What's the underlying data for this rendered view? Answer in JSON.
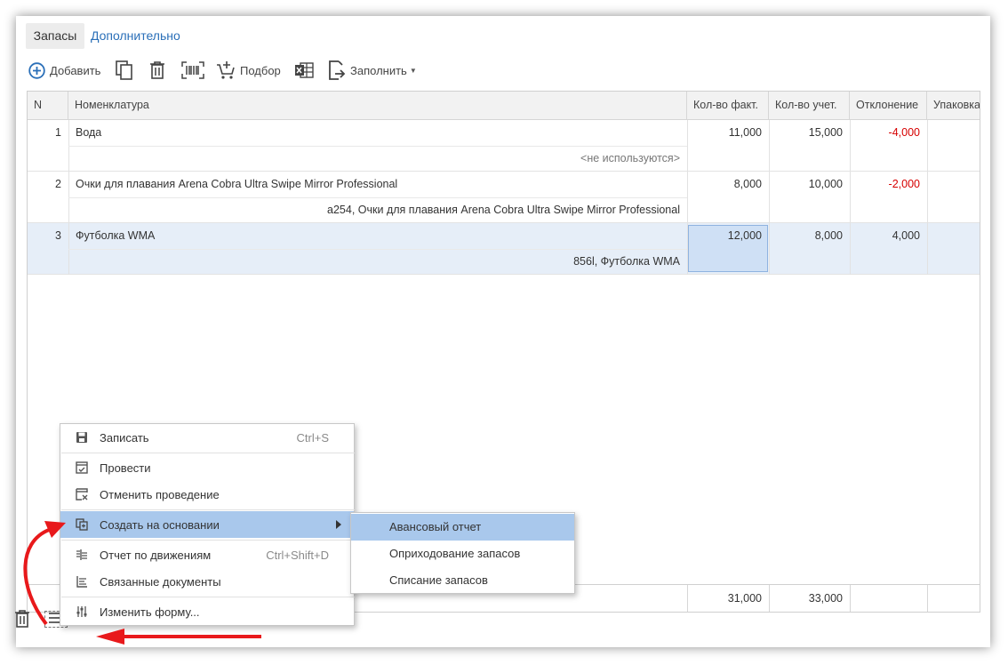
{
  "tabs": [
    "Запасы",
    "Дополнительно"
  ],
  "toolbar": {
    "add_label": "Добавить",
    "pick_label": "Подбор",
    "fill_label": "Заполнить"
  },
  "table": {
    "columns": [
      "N",
      "Номенклатура",
      "Кол-во факт.",
      "Кол-во учет.",
      "Отклонение",
      "Упаковка"
    ],
    "rows": [
      {
        "n": "1",
        "name": "Вода",
        "sub": "<не используются>",
        "fact": "11,000",
        "uch": "15,000",
        "otk": "-4,000"
      },
      {
        "n": "2",
        "name": "Очки для плавания Arena Cobra Ultra Swipe Mirror Professional",
        "sub": "a254, Очки для плавания Arena Cobra Ultra Swipe Mirror Professional",
        "fact": "8,000",
        "uch": "10,000",
        "otk": "-2,000"
      },
      {
        "n": "3",
        "name": "Футболка WMA",
        "sub": "856l, Футболка WMA",
        "fact": "12,000",
        "uch": "8,000",
        "otk": "4,000"
      }
    ],
    "totals": {
      "fact": "31,000",
      "uch": "33,000"
    }
  },
  "menu": {
    "items": [
      {
        "label": "Записать",
        "shortcut": "Ctrl+S"
      },
      {
        "label": "Провести"
      },
      {
        "label": "Отменить проведение"
      },
      {
        "label": "Создать на основании"
      },
      {
        "label": "Отчет по движениям",
        "shortcut": "Ctrl+Shift+D"
      },
      {
        "label": "Связанные документы"
      },
      {
        "label": "Изменить форму..."
      }
    ]
  },
  "submenu": {
    "items": [
      "Авансовый отчет",
      "Оприходование запасов",
      "Списание запасов"
    ]
  },
  "colors": {
    "accent": "#2a6fb8",
    "highlight": "#a9c8ec",
    "negative": "#d60000",
    "arrow": "#e8191b"
  }
}
